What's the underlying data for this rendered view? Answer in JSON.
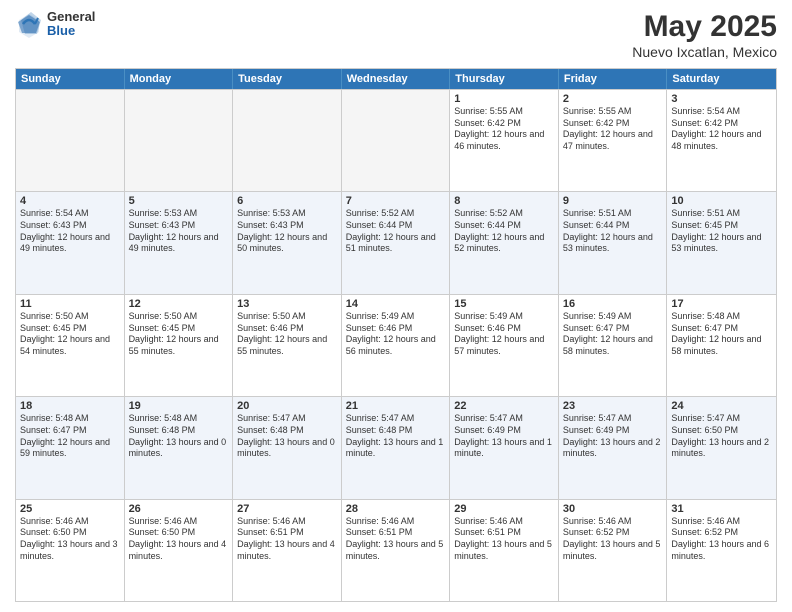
{
  "logo": {
    "general": "General",
    "blue": "Blue"
  },
  "header": {
    "title": "May 2025",
    "subtitle": "Nuevo Ixcatlan, Mexico"
  },
  "weekdays": [
    "Sunday",
    "Monday",
    "Tuesday",
    "Wednesday",
    "Thursday",
    "Friday",
    "Saturday"
  ],
  "weeks": [
    [
      {
        "day": "",
        "empty": true
      },
      {
        "day": "",
        "empty": true
      },
      {
        "day": "",
        "empty": true
      },
      {
        "day": "",
        "empty": true
      },
      {
        "day": "1",
        "sunrise": "5:55 AM",
        "sunset": "6:42 PM",
        "daylight": "12 hours and 46 minutes."
      },
      {
        "day": "2",
        "sunrise": "5:55 AM",
        "sunset": "6:42 PM",
        "daylight": "12 hours and 47 minutes."
      },
      {
        "day": "3",
        "sunrise": "5:54 AM",
        "sunset": "6:42 PM",
        "daylight": "12 hours and 48 minutes."
      }
    ],
    [
      {
        "day": "4",
        "sunrise": "5:54 AM",
        "sunset": "6:43 PM",
        "daylight": "12 hours and 49 minutes."
      },
      {
        "day": "5",
        "sunrise": "5:53 AM",
        "sunset": "6:43 PM",
        "daylight": "12 hours and 49 minutes."
      },
      {
        "day": "6",
        "sunrise": "5:53 AM",
        "sunset": "6:43 PM",
        "daylight": "12 hours and 50 minutes."
      },
      {
        "day": "7",
        "sunrise": "5:52 AM",
        "sunset": "6:44 PM",
        "daylight": "12 hours and 51 minutes."
      },
      {
        "day": "8",
        "sunrise": "5:52 AM",
        "sunset": "6:44 PM",
        "daylight": "12 hours and 52 minutes."
      },
      {
        "day": "9",
        "sunrise": "5:51 AM",
        "sunset": "6:44 PM",
        "daylight": "12 hours and 53 minutes."
      },
      {
        "day": "10",
        "sunrise": "5:51 AM",
        "sunset": "6:45 PM",
        "daylight": "12 hours and 53 minutes."
      }
    ],
    [
      {
        "day": "11",
        "sunrise": "5:50 AM",
        "sunset": "6:45 PM",
        "daylight": "12 hours and 54 minutes."
      },
      {
        "day": "12",
        "sunrise": "5:50 AM",
        "sunset": "6:45 PM",
        "daylight": "12 hours and 55 minutes."
      },
      {
        "day": "13",
        "sunrise": "5:50 AM",
        "sunset": "6:46 PM",
        "daylight": "12 hours and 55 minutes."
      },
      {
        "day": "14",
        "sunrise": "5:49 AM",
        "sunset": "6:46 PM",
        "daylight": "12 hours and 56 minutes."
      },
      {
        "day": "15",
        "sunrise": "5:49 AM",
        "sunset": "6:46 PM",
        "daylight": "12 hours and 57 minutes."
      },
      {
        "day": "16",
        "sunrise": "5:49 AM",
        "sunset": "6:47 PM",
        "daylight": "12 hours and 58 minutes."
      },
      {
        "day": "17",
        "sunrise": "5:48 AM",
        "sunset": "6:47 PM",
        "daylight": "12 hours and 58 minutes."
      }
    ],
    [
      {
        "day": "18",
        "sunrise": "5:48 AM",
        "sunset": "6:47 PM",
        "daylight": "12 hours and 59 minutes."
      },
      {
        "day": "19",
        "sunrise": "5:48 AM",
        "sunset": "6:48 PM",
        "daylight": "13 hours and 0 minutes."
      },
      {
        "day": "20",
        "sunrise": "5:47 AM",
        "sunset": "6:48 PM",
        "daylight": "13 hours and 0 minutes."
      },
      {
        "day": "21",
        "sunrise": "5:47 AM",
        "sunset": "6:48 PM",
        "daylight": "13 hours and 1 minute."
      },
      {
        "day": "22",
        "sunrise": "5:47 AM",
        "sunset": "6:49 PM",
        "daylight": "13 hours and 1 minute."
      },
      {
        "day": "23",
        "sunrise": "5:47 AM",
        "sunset": "6:49 PM",
        "daylight": "13 hours and 2 minutes."
      },
      {
        "day": "24",
        "sunrise": "5:47 AM",
        "sunset": "6:50 PM",
        "daylight": "13 hours and 2 minutes."
      }
    ],
    [
      {
        "day": "25",
        "sunrise": "5:46 AM",
        "sunset": "6:50 PM",
        "daylight": "13 hours and 3 minutes."
      },
      {
        "day": "26",
        "sunrise": "5:46 AM",
        "sunset": "6:50 PM",
        "daylight": "13 hours and 4 minutes."
      },
      {
        "day": "27",
        "sunrise": "5:46 AM",
        "sunset": "6:51 PM",
        "daylight": "13 hours and 4 minutes."
      },
      {
        "day": "28",
        "sunrise": "5:46 AM",
        "sunset": "6:51 PM",
        "daylight": "13 hours and 5 minutes."
      },
      {
        "day": "29",
        "sunrise": "5:46 AM",
        "sunset": "6:51 PM",
        "daylight": "13 hours and 5 minutes."
      },
      {
        "day": "30",
        "sunrise": "5:46 AM",
        "sunset": "6:52 PM",
        "daylight": "13 hours and 5 minutes."
      },
      {
        "day": "31",
        "sunrise": "5:46 AM",
        "sunset": "6:52 PM",
        "daylight": "13 hours and 6 minutes."
      }
    ]
  ],
  "labels": {
    "sunrise": "Sunrise: ",
    "sunset": "Sunset: ",
    "daylight": "Daylight: "
  }
}
